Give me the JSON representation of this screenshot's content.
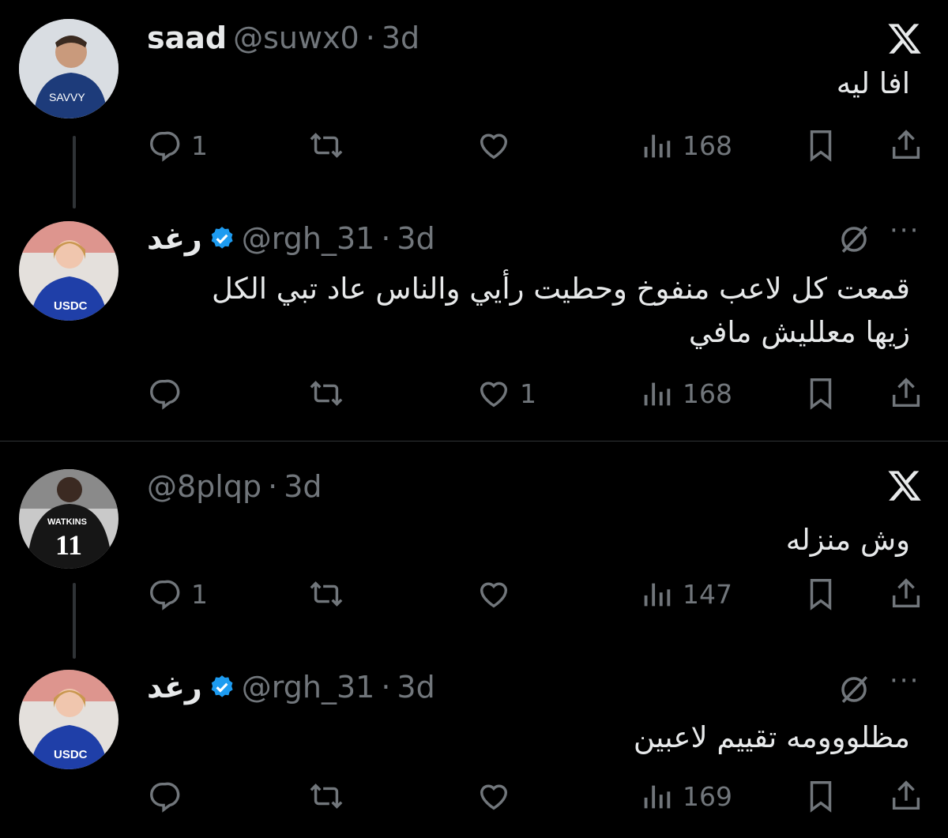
{
  "posts": [
    {
      "name": "saad",
      "handle": "@suwx0",
      "time": "3d",
      "text": "افا ليه",
      "stats": {
        "replies": "1",
        "likes": "",
        "views": "168"
      },
      "avatar_label": "SAVVY",
      "avatar_color": "#1d3b7a"
    },
    {
      "name": "رغد",
      "handle": "@rgh_31",
      "time": "3d",
      "text": "قمعت كل لاعب منفوخ وحطيت رأيي والناس عاد تبي الكل زيها معلليش مافي",
      "stats": {
        "replies": "",
        "likes": "1",
        "views": "168"
      },
      "avatar_label": "USDC",
      "avatar_color": "#1f3fa8",
      "verified": true
    },
    {
      "name": "",
      "handle": "@8plqp",
      "time": "3d",
      "text": "وش منزله",
      "stats": {
        "replies": "1",
        "likes": "",
        "views": "147"
      },
      "avatar_label": "WATKINS",
      "avatar_number": "11",
      "avatar_color": "#111"
    },
    {
      "name": "رغد",
      "handle": "@rgh_31",
      "time": "3d",
      "text": "مظلووومه تقييم لاعبين",
      "stats": {
        "replies": "",
        "likes": "",
        "views": "169"
      },
      "avatar_label": "USDC",
      "avatar_color": "#1f3fa8",
      "verified": true
    }
  ],
  "separator": "·",
  "colors": {
    "background": "#000000",
    "text": "#e7e9ea",
    "muted": "#71767b",
    "verified": "#1d9bf0",
    "divider": "#2f3336"
  },
  "icons": {
    "reply": "reply-icon",
    "repost": "repost-icon",
    "like": "heart-icon",
    "views": "views-icon",
    "bookmark": "bookmark-icon",
    "share": "share-icon",
    "x": "x-logo-icon",
    "grok": "grok-icon",
    "more": "more-icon",
    "verified": "verified-badge-icon"
  }
}
